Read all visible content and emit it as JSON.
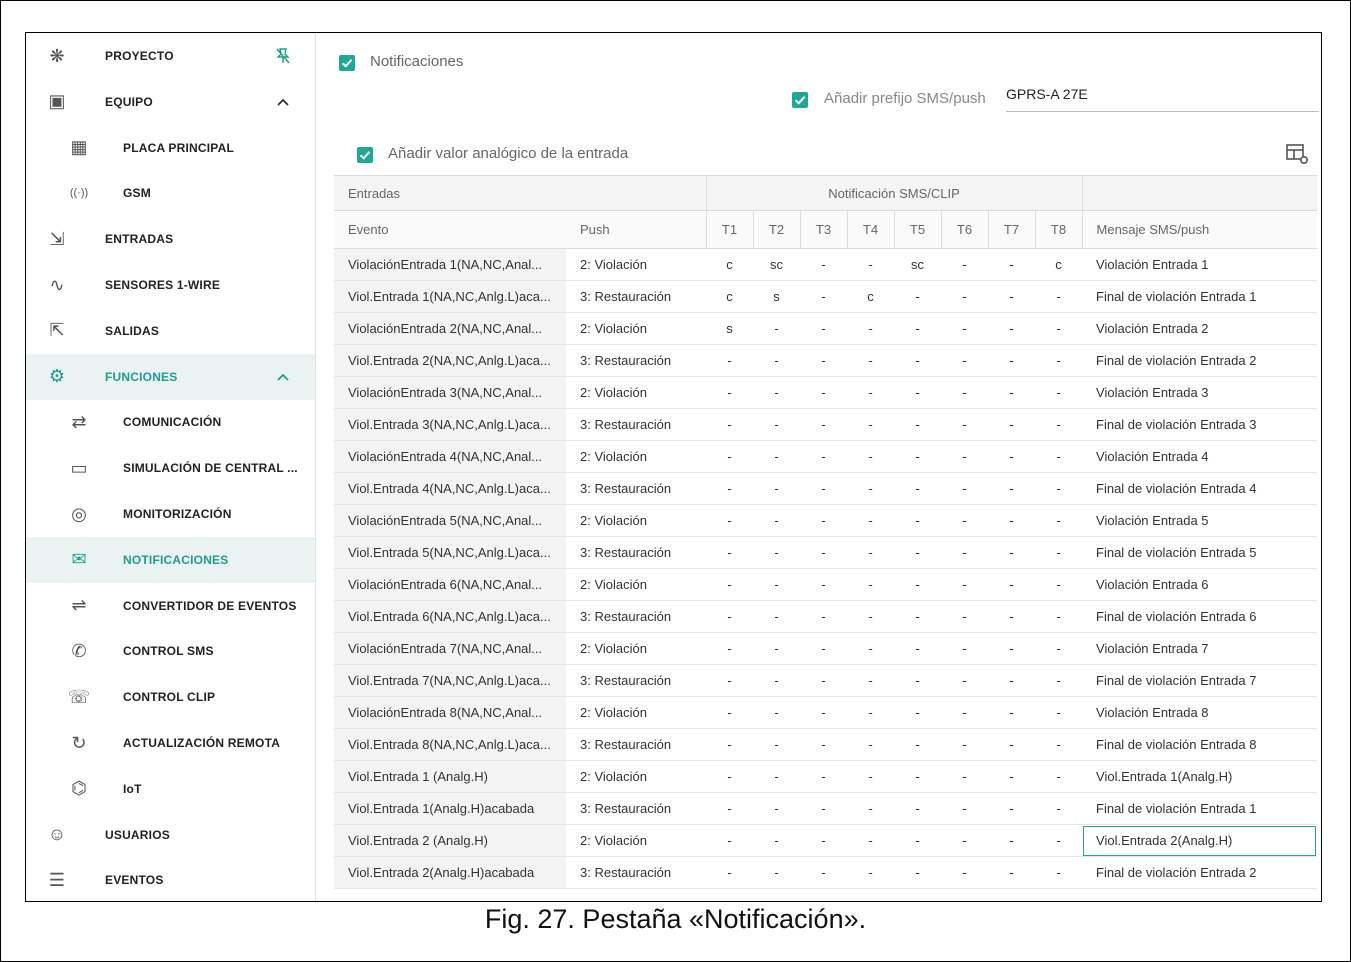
{
  "sidebar": {
    "items": [
      {
        "label": "PROYECTO",
        "icon": "project-icon"
      },
      {
        "label": "EQUIPO",
        "icon": "device-icon"
      },
      {
        "label": "PLACA PRINCIPAL",
        "icon": "board-icon"
      },
      {
        "label": "GSM",
        "icon": "antenna-icon"
      },
      {
        "label": "ENTRADAS",
        "icon": "input-icon"
      },
      {
        "label": "SENSORES 1-WIRE",
        "icon": "sensor-icon"
      },
      {
        "label": "SALIDAS",
        "icon": "output-icon"
      },
      {
        "label": "FUNCIONES",
        "icon": "gear-icon"
      },
      {
        "label": "COMUNICACIÓN",
        "icon": "communication-icon"
      },
      {
        "label": "SIMULACIÓN DE CENTRAL ...",
        "icon": "keypad-icon"
      },
      {
        "label": "MONITORIZACIÓN",
        "icon": "eye-icon"
      },
      {
        "label": "NOTIFICACIONES",
        "icon": "notification-icon"
      },
      {
        "label": "CONVERTIDOR DE EVENTOS",
        "icon": "converter-icon"
      },
      {
        "label": "CONTROL SMS",
        "icon": "sms-icon"
      },
      {
        "label": "CONTROL CLIP",
        "icon": "phone-icon"
      },
      {
        "label": "ACTUALIZACIÓN REMOTA",
        "icon": "refresh-icon"
      },
      {
        "label": "IoT",
        "icon": "iot-icon"
      },
      {
        "label": "USUARIOS",
        "icon": "users-icon"
      },
      {
        "label": "EVENTOS",
        "icon": "events-icon"
      }
    ]
  },
  "main": {
    "notifications_label": "Notificaciones",
    "prefix_label": "Añadir prefijo SMS/push",
    "prefix_value": "GPRS-A 27E",
    "analog_label": "Añadir valor analógico de la entrada",
    "table": {
      "group_headers": {
        "inputs": "Entradas",
        "sms": "Notificación SMS/CLIP"
      },
      "headers": [
        "Evento",
        "Push",
        "T1",
        "T2",
        "T3",
        "T4",
        "T5",
        "T6",
        "T7",
        "T8",
        "Mensaje SMS/push"
      ],
      "rows": [
        [
          "ViolaciónEntrada 1(NA,NC,Anal...",
          "2: Violación",
          "c",
          "sc",
          "-",
          "-",
          "sc",
          "-",
          "-",
          "c",
          "Violación Entrada 1"
        ],
        [
          "Viol.Entrada 1(NA,NC,Anlg.L)aca...",
          "3: Restauración",
          "c",
          "s",
          "-",
          "c",
          "-",
          "-",
          "-",
          "-",
          "Final de violación Entrada 1"
        ],
        [
          "ViolaciónEntrada 2(NA,NC,Anal...",
          "2: Violación",
          "s",
          "-",
          "-",
          "-",
          "-",
          "-",
          "-",
          "-",
          "Violación Entrada 2"
        ],
        [
          "Viol.Entrada 2(NA,NC,Anlg.L)aca...",
          "3: Restauración",
          "-",
          "-",
          "-",
          "-",
          "-",
          "-",
          "-",
          "-",
          "Final de violación Entrada 2"
        ],
        [
          "ViolaciónEntrada 3(NA,NC,Anal...",
          "2: Violación",
          "-",
          "-",
          "-",
          "-",
          "-",
          "-",
          "-",
          "-",
          "Violación Entrada 3"
        ],
        [
          "Viol.Entrada 3(NA,NC,Anlg.L)aca...",
          "3: Restauración",
          "-",
          "-",
          "-",
          "-",
          "-",
          "-",
          "-",
          "-",
          "Final de violación Entrada 3"
        ],
        [
          "ViolaciónEntrada 4(NA,NC,Anal...",
          "2: Violación",
          "-",
          "-",
          "-",
          "-",
          "-",
          "-",
          "-",
          "-",
          "Violación Entrada 4"
        ],
        [
          "Viol.Entrada 4(NA,NC,Anlg.L)aca...",
          "3: Restauración",
          "-",
          "-",
          "-",
          "-",
          "-",
          "-",
          "-",
          "-",
          "Final de violación Entrada 4"
        ],
        [
          "ViolaciónEntrada 5(NA,NC,Anal...",
          "2: Violación",
          "-",
          "-",
          "-",
          "-",
          "-",
          "-",
          "-",
          "-",
          "Violación Entrada 5"
        ],
        [
          "Viol.Entrada 5(NA,NC,Anlg.L)aca...",
          "3: Restauración",
          "-",
          "-",
          "-",
          "-",
          "-",
          "-",
          "-",
          "-",
          "Final de violación Entrada 5"
        ],
        [
          "ViolaciónEntrada 6(NA,NC,Anal...",
          "2: Violación",
          "-",
          "-",
          "-",
          "-",
          "-",
          "-",
          "-",
          "-",
          "Violación Entrada 6"
        ],
        [
          "Viol.Entrada 6(NA,NC,Anlg.L)aca...",
          "3: Restauración",
          "-",
          "-",
          "-",
          "-",
          "-",
          "-",
          "-",
          "-",
          "Final de violación Entrada 6"
        ],
        [
          "ViolaciónEntrada 7(NA,NC,Anal...",
          "2: Violación",
          "-",
          "-",
          "-",
          "-",
          "-",
          "-",
          "-",
          "-",
          "Violación Entrada 7"
        ],
        [
          "Viol.Entrada 7(NA,NC,Anlg.L)aca...",
          "3: Restauración",
          "-",
          "-",
          "-",
          "-",
          "-",
          "-",
          "-",
          "-",
          "Final de violación Entrada 7"
        ],
        [
          "ViolaciónEntrada 8(NA,NC,Anal...",
          "2: Violación",
          "-",
          "-",
          "-",
          "-",
          "-",
          "-",
          "-",
          "-",
          "Violación Entrada 8"
        ],
        [
          "Viol.Entrada 8(NA,NC,Anlg.L)aca...",
          "3: Restauración",
          "-",
          "-",
          "-",
          "-",
          "-",
          "-",
          "-",
          "-",
          "Final de violación Entrada 8"
        ],
        [
          "Viol.Entrada 1 (Analg.H)",
          "2: Violación",
          "-",
          "-",
          "-",
          "-",
          "-",
          "-",
          "-",
          "-",
          "Viol.Entrada 1(Analg.H)"
        ],
        [
          "Viol.Entrada 1(Analg.H)acabada",
          "3: Restauración",
          "-",
          "-",
          "-",
          "-",
          "-",
          "-",
          "-",
          "-",
          "Final de violación Entrada 1"
        ],
        [
          "Viol.Entrada 2 (Analg.H)",
          "2: Violación",
          "-",
          "-",
          "-",
          "-",
          "-",
          "-",
          "-",
          "-",
          "Viol.Entrada 2(Analg.H)"
        ],
        [
          "Viol.Entrada 2(Analg.H)acabada",
          "3: Restauración",
          "-",
          "-",
          "-",
          "-",
          "-",
          "-",
          "-",
          "-",
          "Final de violación Entrada 2"
        ]
      ]
    }
  },
  "caption": "Fig. 27. Pestaña «Notificación».",
  "colors": {
    "accent": "#1fa895",
    "active_bg": "#eaf3f1"
  }
}
